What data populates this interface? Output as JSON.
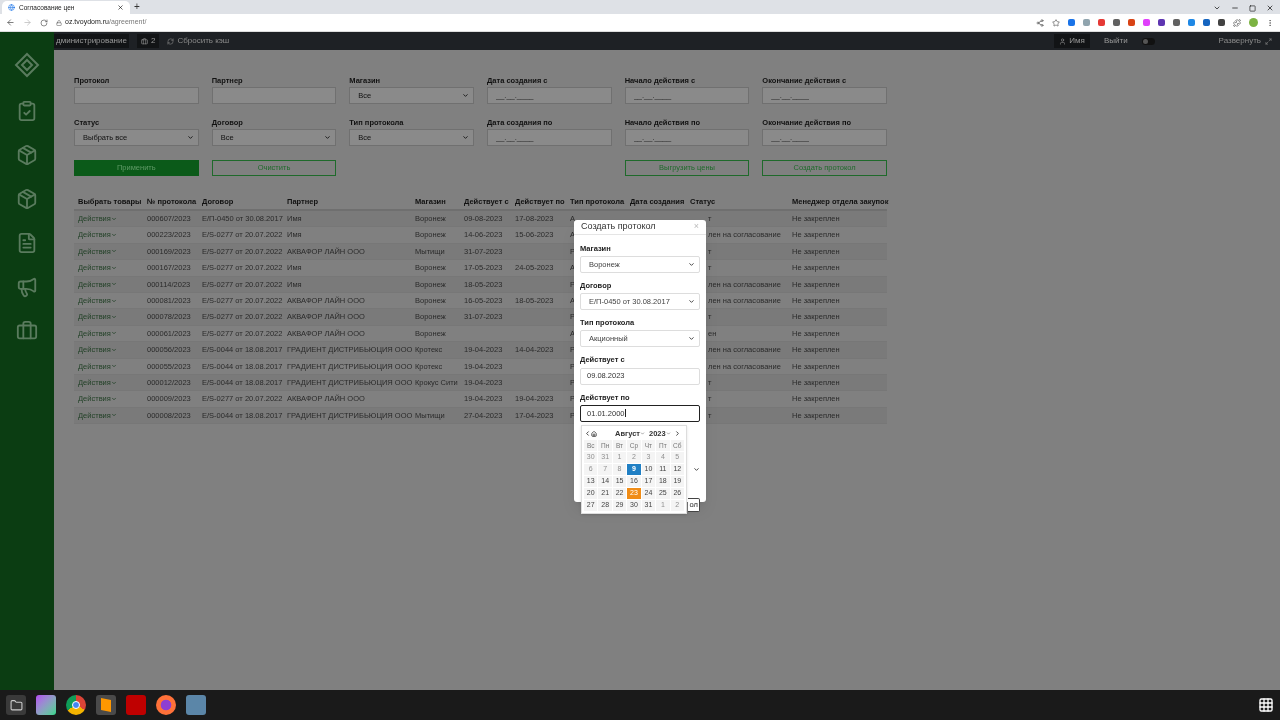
{
  "browser": {
    "tab_title": "Согласование цен",
    "url_host": "oz.tvoydom.ru",
    "url_path": "/agreement/",
    "new_tab": "+"
  },
  "header": {
    "admin": "дминистрирование",
    "badge": "2",
    "reset": "Сбросить кэш",
    "user": "Имя",
    "logout": "Выйти",
    "toggle_on": false,
    "expand": "Развернуть"
  },
  "filters": [
    {
      "label": "Протокол",
      "kind": "text"
    },
    {
      "label": "Партнер",
      "kind": "text"
    },
    {
      "label": "Магазин",
      "kind": "select",
      "value": "Все"
    },
    {
      "label": "Дата создания с",
      "kind": "date",
      "placeholder": "__.__.____"
    },
    {
      "label": "Начало действия с",
      "kind": "date",
      "placeholder": "__.__.____"
    },
    {
      "label": "Окончание действия с",
      "kind": "date",
      "placeholder": "__.__.____"
    },
    {
      "label": "Статус",
      "kind": "select",
      "value": "Выбрать все"
    },
    {
      "label": "Договор",
      "kind": "select",
      "value": "Все"
    },
    {
      "label": "Тип протокола",
      "kind": "select",
      "value": "Все"
    },
    {
      "label": "Дата создания по",
      "kind": "date",
      "placeholder": "__.__.____"
    },
    {
      "label": "Начало действия по",
      "kind": "date",
      "placeholder": "__.__.____"
    },
    {
      "label": "Окончание действия по",
      "kind": "date",
      "placeholder": "__.__.____"
    }
  ],
  "actions": [
    {
      "label": "Применить",
      "kind": "primary"
    },
    {
      "label": "Очистить",
      "kind": "outline"
    },
    {
      "label": "Выгрузить цены",
      "kind": "outline"
    },
    {
      "label": "Создать протокол",
      "kind": "outline"
    }
  ],
  "table": {
    "columns": [
      "Выбрать товары",
      "№ протокола",
      "Договор",
      "Партнер",
      "Магазин",
      "Действует с",
      "Действует по",
      "Тип протокола",
      "Дата создания",
      "Статус",
      "Менеджер отдела закупок"
    ],
    "rows": [
      {
        "action": "Действия",
        "number": "000607/2023",
        "contract": "Е/П-0450 от 30.08.2017",
        "partner": "Имя",
        "store": "Воронеж",
        "from": "09-08-2023",
        "to": "17-08-2023",
        "type": "А",
        "status": "т",
        "manager": "Не закреплен"
      },
      {
        "action": "Действия",
        "number": "000223/2023",
        "contract": "Е/S-0277 от 20.07.2022",
        "partner": "Имя",
        "store": "Воронеж",
        "from": "14-06-2023",
        "to": "15-06-2023",
        "type": "А",
        "status": "лен на согласование",
        "manager": "Не закреплен"
      },
      {
        "action": "Действия",
        "number": "000169/2023",
        "contract": "Е/S-0277 от 20.07.2022",
        "partner": "АКВАФОР ЛАЙН ООО",
        "store": "Мытищи",
        "from": "31-07-2023",
        "type": "Р",
        "status": "т",
        "manager": "Не закреплен"
      },
      {
        "action": "Действия",
        "number": "000167/2023",
        "contract": "Е/S-0277 от 20.07.2022",
        "partner": "Имя",
        "store": "Воронеж",
        "from": "17-05-2023",
        "to": "24-05-2023",
        "type": "А",
        "status": "т",
        "manager": "Не закреплен"
      },
      {
        "action": "Действия",
        "number": "000114/2023",
        "contract": "Е/S-0277 от 20.07.2022",
        "partner": "Имя",
        "store": "Воронеж",
        "from": "18-05-2023",
        "type": "Р",
        "status": "лен на согласование",
        "manager": "Не закреплен"
      },
      {
        "action": "Действия",
        "number": "000081/2023",
        "contract": "Е/S-0277 от 20.07.2022",
        "partner": "АКВАФОР ЛАЙН ООО",
        "store": "Воронеж",
        "from": "16-05-2023",
        "to": "18-05-2023",
        "type": "А",
        "status": "лен на согласование",
        "manager": "Не закреплен"
      },
      {
        "action": "Действия",
        "number": "000078/2023",
        "contract": "Е/S-0277 от 20.07.2022",
        "partner": "АКВАФОР ЛАЙН ООО",
        "store": "Воронеж",
        "from": "31-07-2023",
        "type": "Р",
        "status": "т",
        "manager": "Не закреплен"
      },
      {
        "action": "Действия",
        "number": "000061/2023",
        "contract": "Е/S-0277 от 20.07.2022",
        "partner": "АКВАФОР ЛАЙН ООО",
        "store": "Воронеж",
        "type": "А",
        "status": "ен",
        "manager": "Не закреплен"
      },
      {
        "action": "Действия",
        "number": "000056/2023",
        "contract": "Е/S-0044 от 18.08.2017",
        "partner": "ГРАДИЕНТ ДИСТРИБЬЮЦИЯ ООО",
        "store": "Кротекс",
        "from": "19-04-2023",
        "to": "14-04-2023",
        "type": "Р",
        "status": "лен на согласование",
        "manager": "Не закреплен"
      },
      {
        "action": "Действия",
        "number": "000055/2023",
        "contract": "Е/S-0044 от 18.08.2017",
        "partner": "ГРАДИЕНТ ДИСТРИБЬЮЦИЯ ООО",
        "store": "Кротекс",
        "from": "19-04-2023",
        "type": "Р",
        "status": "лен на согласование",
        "manager": "Не закреплен"
      },
      {
        "action": "Действия",
        "number": "000012/2023",
        "contract": "Е/S-0044 от 18.08.2017",
        "partner": "ГРАДИЕНТ ДИСТРИБЬЮЦИЯ ООО",
        "store": "Крокус Сити",
        "from": "19-04-2023",
        "type": "Р",
        "status": "т",
        "manager": "Не закреплен"
      },
      {
        "action": "Действия",
        "number": "000009/2023",
        "contract": "Е/S-0277 от 20.07.2022",
        "partner": "АКВАФОР ЛАЙН ООО",
        "from": "19-04-2023",
        "to": "19-04-2023",
        "type": "Р",
        "status": "т",
        "manager": "Не закреплен"
      },
      {
        "action": "Действия",
        "number": "000008/2023",
        "contract": "Е/S-0044 от 18.08.2017",
        "partner": "ГРАДИЕНТ ДИСТРИБЬЮЦИЯ ООО",
        "store": "Мытищи",
        "from": "27-04-2023",
        "to": "17-04-2023",
        "type": "Р",
        "status": "т",
        "manager": "Не закреплен"
      }
    ]
  },
  "modal": {
    "title": "Создать протокол",
    "close": "×",
    "fields": [
      {
        "label": "Магазин",
        "kind": "select",
        "value": "Воронеж",
        "focused": false
      },
      {
        "label": "Договор",
        "kind": "select",
        "value": "Е/П-0450 от 30.08.2017",
        "focused": false
      },
      {
        "label": "Тип протокола",
        "kind": "select",
        "value": "Акционный",
        "focused": false
      },
      {
        "label": "Действует с",
        "kind": "text",
        "value": "09.08.2023",
        "focused": false
      },
      {
        "label": "Действует по",
        "kind": "text",
        "value": "01.01.2000",
        "focused": true
      }
    ],
    "submit": "ол"
  },
  "calendar": {
    "month": "Август",
    "year": "2023",
    "weekdays": [
      "Вс",
      "Пн",
      "Вт",
      "Ср",
      "Чт",
      "Пт",
      "Сб"
    ],
    "days": [
      {
        "text": "30",
        "disabled": true,
        "selected": false,
        "today": false
      },
      {
        "text": "31",
        "disabled": true,
        "selected": false,
        "today": false
      },
      {
        "text": "1",
        "disabled": true,
        "selected": false,
        "today": false
      },
      {
        "text": "2",
        "disabled": true,
        "selected": false,
        "today": false
      },
      {
        "text": "3",
        "disabled": true,
        "selected": false,
        "today": false
      },
      {
        "text": "4",
        "disabled": true,
        "selected": false,
        "today": false
      },
      {
        "text": "5",
        "disabled": true,
        "selected": false,
        "today": false
      },
      {
        "text": "6",
        "disabled": true,
        "selected": false,
        "today": false
      },
      {
        "text": "7",
        "disabled": true,
        "selected": false,
        "today": false
      },
      {
        "text": "8",
        "disabled": true,
        "selected": false,
        "today": false
      },
      {
        "text": "9",
        "disabled": false,
        "selected": true,
        "today": false
      },
      {
        "text": "10",
        "disabled": false,
        "selected": false,
        "today": false
      },
      {
        "text": "11",
        "disabled": false,
        "selected": false,
        "today": false
      },
      {
        "text": "12",
        "disabled": false,
        "selected": false,
        "today": false
      },
      {
        "text": "13",
        "disabled": false,
        "selected": false,
        "today": false
      },
      {
        "text": "14",
        "disabled": false,
        "selected": false,
        "today": false
      },
      {
        "text": "15",
        "disabled": false,
        "selected": false,
        "today": false
      },
      {
        "text": "16",
        "disabled": false,
        "selected": false,
        "today": false
      },
      {
        "text": "17",
        "disabled": false,
        "selected": false,
        "today": false
      },
      {
        "text": "18",
        "disabled": false,
        "selected": false,
        "today": false
      },
      {
        "text": "19",
        "disabled": false,
        "selected": false,
        "today": false
      },
      {
        "text": "20",
        "disabled": false,
        "selected": false,
        "today": false
      },
      {
        "text": "21",
        "disabled": false,
        "selected": false,
        "today": false
      },
      {
        "text": "22",
        "disabled": false,
        "selected": false,
        "today": false
      },
      {
        "text": "23",
        "disabled": false,
        "selected": false,
        "today": true
      },
      {
        "text": "24",
        "disabled": false,
        "selected": false,
        "today": false
      },
      {
        "text": "25",
        "disabled": false,
        "selected": false,
        "today": false
      },
      {
        "text": "26",
        "disabled": false,
        "selected": false,
        "today": false
      },
      {
        "text": "27",
        "disabled": false,
        "selected": false,
        "today": false
      },
      {
        "text": "28",
        "disabled": false,
        "selected": false,
        "today": false
      },
      {
        "text": "29",
        "disabled": false,
        "selected": false,
        "today": false
      },
      {
        "text": "30",
        "disabled": false,
        "selected": false,
        "today": false
      },
      {
        "text": "31",
        "disabled": false,
        "selected": false,
        "today": false
      },
      {
        "text": "1",
        "disabled": true,
        "selected": false,
        "today": false
      },
      {
        "text": "2",
        "disabled": true,
        "selected": false,
        "today": false
      }
    ]
  }
}
